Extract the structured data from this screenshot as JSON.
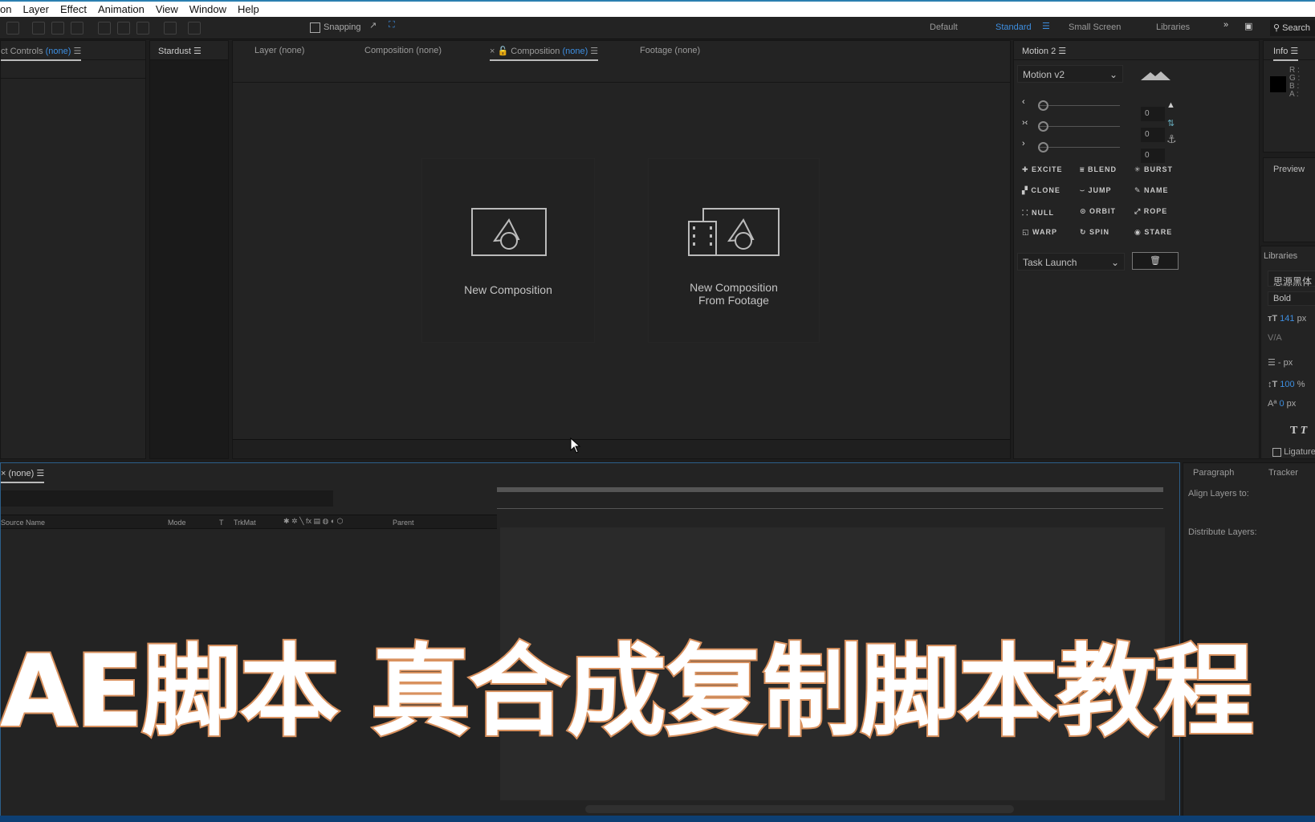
{
  "menu": [
    "on",
    "Layer",
    "Effect",
    "Animation",
    "View",
    "Window",
    "Help"
  ],
  "toolbar": {
    "snapping": "Snapping"
  },
  "workspaces": [
    "Default",
    "Standard",
    "Small Screen",
    "Libraries"
  ],
  "search_label": "Search",
  "panels": {
    "effect_controls": {
      "label": "ct Controls",
      "none": "(none)"
    },
    "stardust": "Stardust",
    "viewer_tabs": {
      "layer": "Layer (none)",
      "composition1": "Composition (none)",
      "composition2": "Composition",
      "composition2_none": "(none)",
      "footage": "Footage (none)"
    },
    "cards": {
      "new_comp": "New Composition",
      "new_from_footage_1": "New Composition",
      "new_from_footage_2": "From Footage"
    }
  },
  "motion": {
    "title": "Motion 2",
    "preset": "Motion v2",
    "values": [
      "0",
      "0",
      "0"
    ],
    "buttons": [
      "EXCITE",
      "BLEND",
      "BURST",
      "CLONE",
      "JUMP",
      "NAME",
      "NULL",
      "ORBIT",
      "ROPE",
      "WARP",
      "SPIN",
      "STARE"
    ],
    "task": "Task Launch"
  },
  "info": {
    "title": "Info",
    "channels": [
      "R :",
      "G :",
      "B :",
      "A :"
    ]
  },
  "preview": {
    "title": "Preview"
  },
  "libraries": {
    "title": "Libraries",
    "font": "思源黑体",
    "style": "Bold",
    "size": "141",
    "size_unit": "px",
    "leading": "- px",
    "vscale": "100",
    "vscale_unit": "%",
    "baseline": "0",
    "baseline_unit": "px",
    "ligatures": "Ligatures"
  },
  "timeline": {
    "tab": "(none)",
    "cols": {
      "source": "Source Name",
      "mode": "Mode",
      "t": "T",
      "trkmat": "TrkMat",
      "parent": "Parent"
    }
  },
  "align": {
    "tabs": [
      "Paragraph",
      "Tracker"
    ],
    "align_to": "Align Layers to:",
    "distribute": "Distribute Layers:"
  },
  "overlay_title": "AE脚本 真合成复制脚本教程",
  "colors": {
    "accent": "#3d8ee0",
    "title_stroke": "#d9915e"
  }
}
